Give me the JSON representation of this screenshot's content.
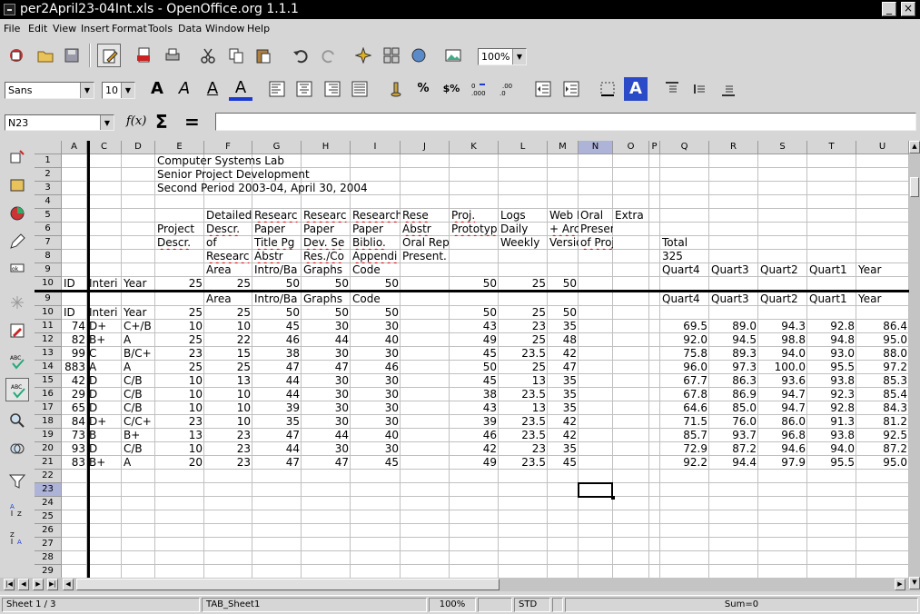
{
  "window": {
    "title": "per2April23-04Int.xls - OpenOffice.org 1.1.1"
  },
  "menu": [
    "File",
    "Edit",
    "View",
    "Insert",
    "Format",
    "Tools",
    "Data",
    "Window",
    "Help"
  ],
  "toolbar": {
    "zoom": "100%",
    "font_name": "Sans",
    "font_size": "10",
    "number_format_currency": "$%",
    "number_format_percent": "%"
  },
  "formula": {
    "cell_ref": "N23",
    "content": "",
    "function_label": "f(x)",
    "sum_label": "Σ",
    "equals_label": "="
  },
  "columns": [
    "A",
    "C",
    "D",
    "E",
    "F",
    "G",
    "H",
    "I",
    "J",
    "K",
    "L",
    "M",
    "N",
    "O",
    "P",
    "Q",
    "R",
    "S",
    "T",
    "U"
  ],
  "rows_frozen": [
    "1",
    "2",
    "3",
    "4",
    "5",
    "6",
    "7",
    "8",
    "9",
    "10"
  ],
  "rows_scrolled": [
    "9",
    "10",
    "11",
    "12",
    "13",
    "14",
    "15",
    "16",
    "17",
    "18",
    "19",
    "20",
    "21",
    "22",
    "23",
    "24",
    "25",
    "26",
    "27",
    "28",
    "29"
  ],
  "header": {
    "title1": "Computer Systems Lab",
    "title2": "Senior Project Development",
    "title3": "Second Period 2003-04, April 30, 2004",
    "r5": {
      "F": "Detailed",
      "G": "Researc",
      "H": "Researc",
      "I": "Research",
      "J": "Rese",
      "K": "Proj.",
      "L": "Logs",
      "M": "Web Po",
      "N": "Oral",
      "O": "Extra"
    },
    "r6": {
      "E": "Project",
      "F": "Descr.",
      "G": "Paper",
      "H": "Paper",
      "I": "Paper",
      "J": "Abstr",
      "K": "Prototyp",
      "L": "Daily",
      "M": "+ Archiv",
      "N": "Present."
    },
    "r7": {
      "E": "Descr.",
      "F": "of",
      "G": "Title Pg",
      "H": "Dev. Se",
      "I": "Biblio.",
      "J": "Oral Rep",
      "L": "Weekly",
      "M": "Version",
      "N": "of Proj.",
      "Q": "Total"
    },
    "r8": {
      "F": "Researc",
      "G": "Abstr",
      "H": "Res./Co",
      "I": "Appendi",
      "J": "Present.",
      "Q": "325"
    },
    "r9": {
      "F": "Area",
      "G": "Intro/Ba",
      "H": "Graphs",
      "I": "Code",
      "Q": "Quart4",
      "R": "Quart3",
      "S": "Quart2",
      "T": "Quart1",
      "U": "Year"
    },
    "r10": {
      "A": "ID",
      "C": "Interi",
      "D": "Year",
      "E": "25",
      "F": "25",
      "G": "50",
      "H": "50",
      "I": "50",
      "K": "50",
      "L": "25",
      "M": "50"
    }
  },
  "data_rows": [
    {
      "A": "74",
      "C": "D+",
      "D": "C+/B",
      "E": "10",
      "F": "10",
      "G": "45",
      "H": "30",
      "I": "30",
      "K": "43",
      "L": "23",
      "M": "35",
      "Q": "69.5",
      "R": "89.0",
      "S": "94.3",
      "T": "92.8",
      "U": "86.4"
    },
    {
      "A": "82",
      "C": "B+",
      "D": "A",
      "E": "25",
      "F": "22",
      "G": "46",
      "H": "44",
      "I": "40",
      "K": "49",
      "L": "25",
      "M": "48",
      "Q": "92.0",
      "R": "94.5",
      "S": "98.8",
      "T": "94.8",
      "U": "95.0"
    },
    {
      "A": "99",
      "C": "C",
      "D": "B/C+",
      "E": "23",
      "F": "15",
      "G": "38",
      "H": "30",
      "I": "30",
      "K": "45",
      "L": "23.5",
      "M": "42",
      "Q": "75.8",
      "R": "89.3",
      "S": "94.0",
      "T": "93.0",
      "U": "88.0"
    },
    {
      "A": "883",
      "C": "A",
      "D": "A",
      "E": "25",
      "F": "25",
      "G": "47",
      "H": "47",
      "I": "46",
      "K": "50",
      "L": "25",
      "M": "47",
      "Q": "96.0",
      "R": "97.3",
      "S": "100.0",
      "T": "95.5",
      "U": "97.2"
    },
    {
      "A": "42",
      "C": "D",
      "D": "C/B",
      "E": "10",
      "F": "13",
      "G": "44",
      "H": "30",
      "I": "30",
      "K": "45",
      "L": "13",
      "M": "35",
      "Q": "67.7",
      "R": "86.3",
      "S": "93.6",
      "T": "93.8",
      "U": "85.3"
    },
    {
      "A": "29",
      "C": "D",
      "D": "C/B",
      "E": "10",
      "F": "10",
      "G": "44",
      "H": "30",
      "I": "30",
      "K": "38",
      "L": "23.5",
      "M": "35",
      "Q": "67.8",
      "R": "86.9",
      "S": "94.7",
      "T": "92.3",
      "U": "85.4"
    },
    {
      "A": "65",
      "C": "D",
      "D": "C/B",
      "E": "10",
      "F": "10",
      "G": "39",
      "H": "30",
      "I": "30",
      "K": "43",
      "L": "13",
      "M": "35",
      "Q": "64.6",
      "R": "85.0",
      "S": "94.7",
      "T": "92.8",
      "U": "84.3"
    },
    {
      "A": "84",
      "C": "D+",
      "D": "C/C+",
      "E": "23",
      "F": "10",
      "G": "35",
      "H": "30",
      "I": "30",
      "K": "39",
      "L": "23.5",
      "M": "42",
      "Q": "71.5",
      "R": "76.0",
      "S": "86.0",
      "T": "91.3",
      "U": "81.2"
    },
    {
      "A": "73",
      "C": "B",
      "D": "B+",
      "E": "13",
      "F": "23",
      "G": "47",
      "H": "44",
      "I": "40",
      "K": "46",
      "L": "23.5",
      "M": "42",
      "Q": "85.7",
      "R": "93.7",
      "S": "96.8",
      "T": "93.8",
      "U": "92.5"
    },
    {
      "A": "93",
      "C": "D",
      "D": "C/B",
      "E": "10",
      "F": "23",
      "G": "44",
      "H": "30",
      "I": "30",
      "K": "42",
      "L": "23",
      "M": "35",
      "Q": "72.9",
      "R": "87.2",
      "S": "94.6",
      "T": "94.0",
      "U": "87.2"
    },
    {
      "A": "83",
      "C": "B+",
      "D": "A",
      "E": "20",
      "F": "23",
      "G": "47",
      "H": "47",
      "I": "45",
      "K": "49",
      "L": "23.5",
      "M": "45",
      "Q": "92.2",
      "R": "94.4",
      "S": "97.9",
      "T": "95.5",
      "U": "95.0"
    }
  ],
  "status": {
    "sheet": "Sheet 1 / 3",
    "page_style": "TAB_Sheet1",
    "zoom": "100%",
    "mode": "STD",
    "sum": "Sum=0"
  }
}
